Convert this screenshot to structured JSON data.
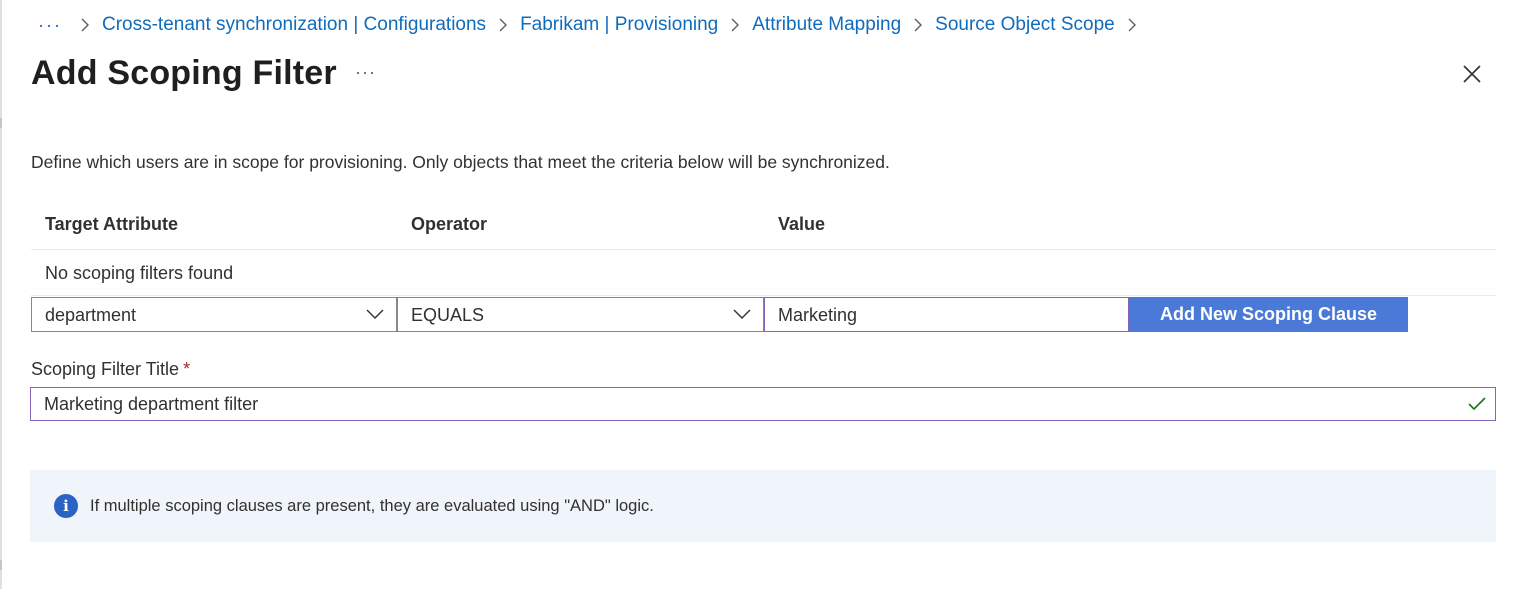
{
  "breadcrumb": {
    "ellipsis": "···",
    "items": [
      "Cross-tenant synchronization | Configurations",
      "Fabrikam | Provisioning",
      "Attribute Mapping",
      "Source Object Scope"
    ]
  },
  "header": {
    "title": "Add Scoping Filter",
    "more": "···"
  },
  "description": "Define which users are in scope for provisioning. Only objects that meet the criteria below will be synchronized.",
  "table": {
    "columns": [
      "Target Attribute",
      "Operator",
      "Value"
    ],
    "empty_message": "No scoping filters found"
  },
  "clause": {
    "attribute_value": "department",
    "operator_value": "EQUALS",
    "value": "Marketing",
    "add_button_label": "Add New Scoping Clause"
  },
  "filter_title": {
    "label": "Scoping Filter Title",
    "required_marker": "*",
    "value": "Marketing department filter"
  },
  "info": {
    "text": "If multiple scoping clauses are present, they are evaluated using \"AND\" logic."
  },
  "colors": {
    "link": "#0f6cbd",
    "primary_button": "#4a79d8",
    "focus_border": "#8764b8",
    "info_background": "#f0f4fb",
    "info_icon": "#2b63c4",
    "valid_check": "#107c10",
    "required": "#a4262c"
  }
}
